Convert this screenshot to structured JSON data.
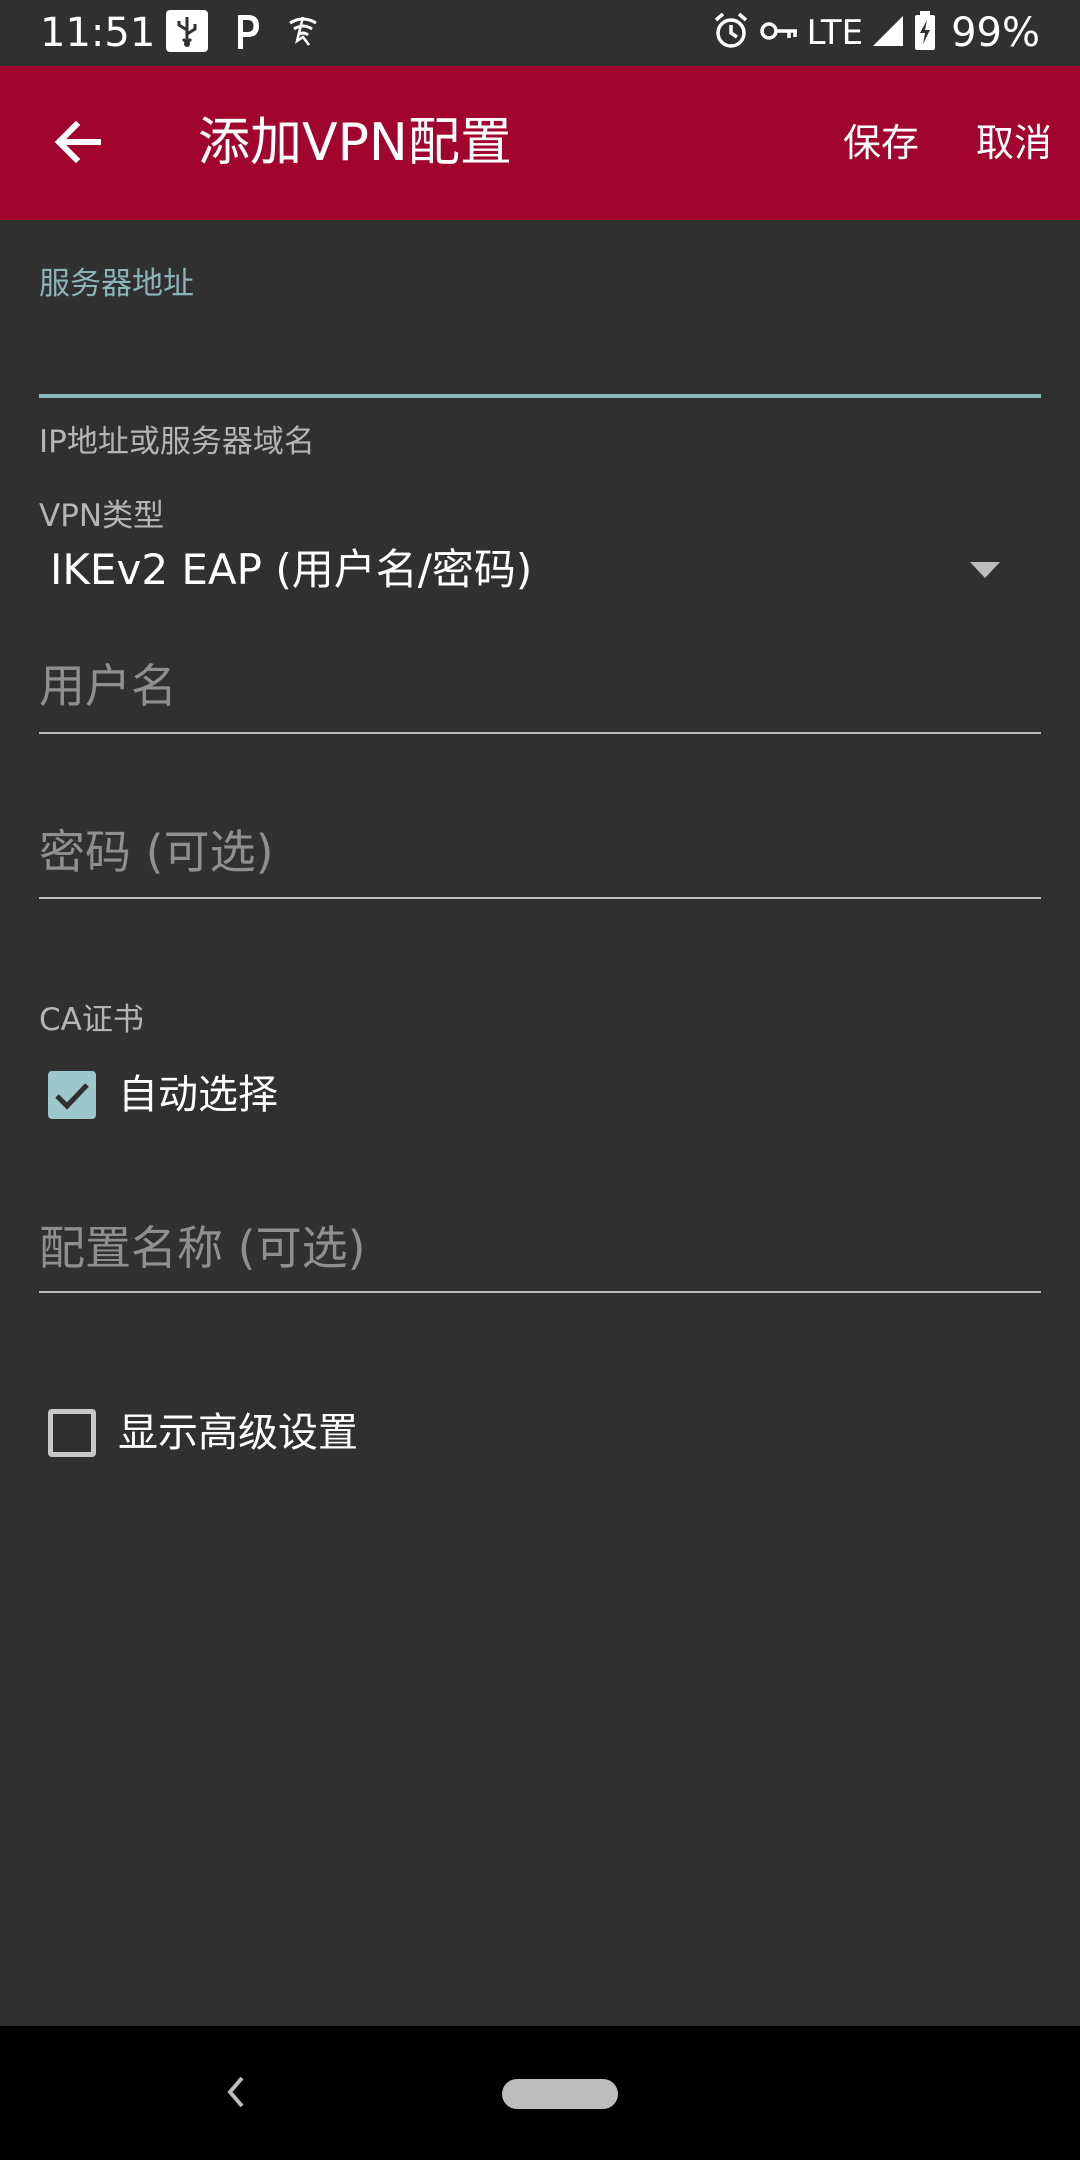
{
  "status_bar": {
    "time": "11:51",
    "network_label": "LTE",
    "battery": "99%",
    "left_icons": [
      "usb-icon",
      "p-app-icon",
      "wifi-assist-icon"
    ],
    "right_icons": [
      "alarm-icon",
      "vpn-key-icon",
      "signal-icon",
      "battery-charging-icon"
    ]
  },
  "toolbar": {
    "title": "添加VPN配置",
    "save_label": "保存",
    "cancel_label": "取消",
    "background_color": "#a1052e"
  },
  "form": {
    "server": {
      "label": "服务器地址",
      "value": "",
      "helper": "IP地址或服务器域名"
    },
    "vpn_type": {
      "label": "VPN类型",
      "value": "IKEv2 EAP (用户名/密码)"
    },
    "username": {
      "placeholder": "用户名",
      "value": ""
    },
    "password": {
      "placeholder": "密码 (可选)",
      "value": ""
    },
    "ca_cert": {
      "label": "CA证书",
      "auto_select_label": "自动选择",
      "auto_select_checked": true
    },
    "profile_name": {
      "placeholder": "配置名称 (可选)",
      "value": ""
    },
    "advanced": {
      "label": "显示高级设置",
      "checked": false
    }
  },
  "colors": {
    "accent": "#8ab8b8",
    "background": "#303030"
  }
}
